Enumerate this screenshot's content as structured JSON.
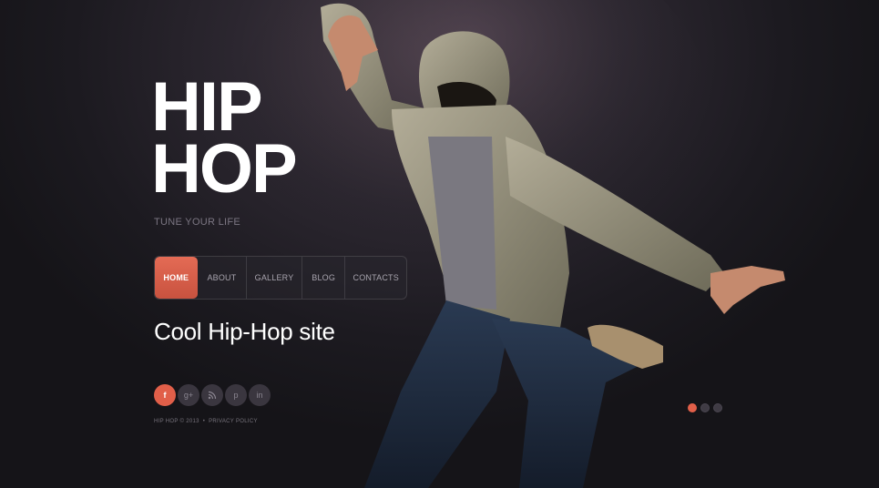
{
  "logo": {
    "line1": "HIP",
    "line2": "HOP"
  },
  "tagline": "TUNE YOUR LIFE",
  "nav": {
    "items": [
      {
        "label": "HOME",
        "active": true
      },
      {
        "label": "ABOUT"
      },
      {
        "label": "GALLERY"
      },
      {
        "label": "BLOG"
      },
      {
        "label": "CONTACTS"
      }
    ]
  },
  "headline": "Cool Hip-Hop site",
  "social": {
    "icons": [
      {
        "name": "facebook-icon",
        "glyph": "f"
      },
      {
        "name": "google-plus-icon",
        "glyph": "g+"
      },
      {
        "name": "rss-icon",
        "glyph": ")"
      },
      {
        "name": "pinterest-icon",
        "glyph": "p"
      },
      {
        "name": "linkedin-icon",
        "glyph": "in"
      }
    ]
  },
  "footer": {
    "copyright": "HIP HOP © 2013",
    "separator": "•",
    "privacy": "PRIVACY POLICY"
  },
  "slider": {
    "slide_count": 3,
    "active_index": 0
  },
  "colors": {
    "accent": "#e15f49",
    "background": "#1c1a20"
  }
}
